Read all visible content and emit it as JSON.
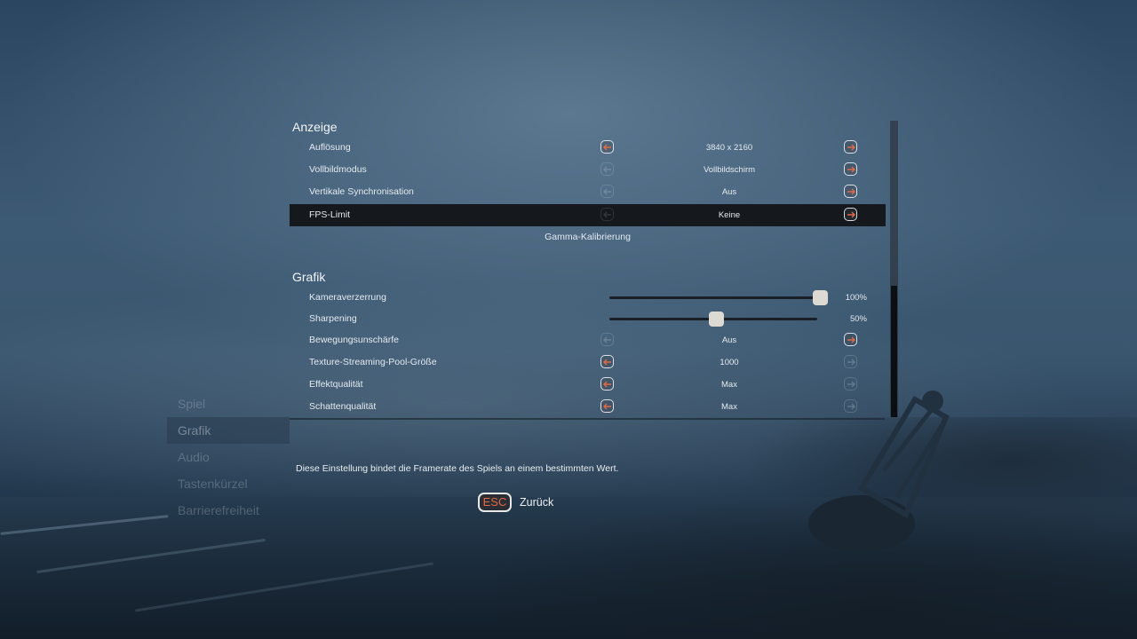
{
  "sidebar": {
    "items": [
      {
        "label": "Spiel"
      },
      {
        "label": "Grafik"
      },
      {
        "label": "Audio"
      },
      {
        "label": "Tastenkürzel"
      },
      {
        "label": "Barrierefreiheit"
      }
    ],
    "active": "Grafik"
  },
  "display": {
    "title": "Anzeige",
    "rows": [
      {
        "label": "Auflösung",
        "value": "3840 x 2160"
      },
      {
        "label": "Vollbildmodus",
        "value": "Vollbildschirm"
      },
      {
        "label": "Vertikale Synchronisation",
        "value": "Aus"
      },
      {
        "label": "FPS-Limit",
        "value": "Keine"
      }
    ],
    "gamma_label": "Gamma-Kalibrierung"
  },
  "graphics": {
    "title": "Grafik",
    "sliders": [
      {
        "label": "Kameraverzerrung",
        "value_text": "100%",
        "value": 1.0
      },
      {
        "label": "Sharpening",
        "value_text": "50%",
        "value": 0.5
      }
    ],
    "rows": [
      {
        "label": "Bewegungsunschärfe",
        "value": "Aus"
      },
      {
        "label": "Texture-Streaming-Pool-Größe",
        "value": "1000"
      },
      {
        "label": "Effektqualität",
        "value": "Max"
      },
      {
        "label": "Schattenqualität",
        "value": "Max"
      }
    ]
  },
  "description": "Diese Einstellung bindet die Framerate des Spiels an einem bestimmten Wert.",
  "back": {
    "key": "ESC",
    "label": "Zurück"
  },
  "colors": {
    "accent": "#e06a47",
    "selected_row": "#15181c"
  }
}
